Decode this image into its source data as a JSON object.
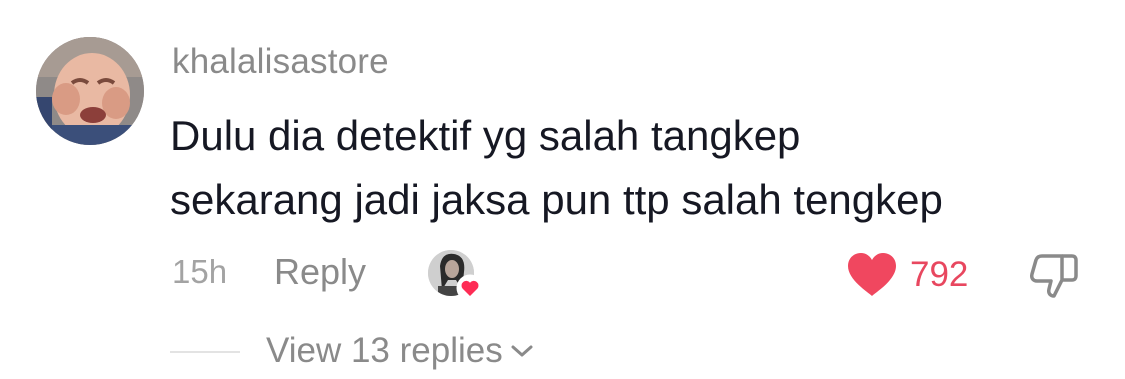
{
  "comment": {
    "username": "khalalisastore",
    "text_lines": [
      "Dulu dia detektif yg salah tangkep",
      "sekarang jadi jaksa pun ttp salah tengkep"
    ],
    "timestamp": "15h",
    "reply_label": "Reply",
    "like_count": "792",
    "view_replies_label": "View 13 replies"
  },
  "colors": {
    "like": "#fe2c55",
    "muted_text": "#8a8a8a",
    "primary_text": "#161823"
  },
  "icons": {
    "avatar": "baby-photo-avatar",
    "creator_liked": "creator-avatar-with-heart",
    "like": "heart-icon",
    "dislike": "thumbs-down-icon",
    "expand": "chevron-down-icon"
  }
}
